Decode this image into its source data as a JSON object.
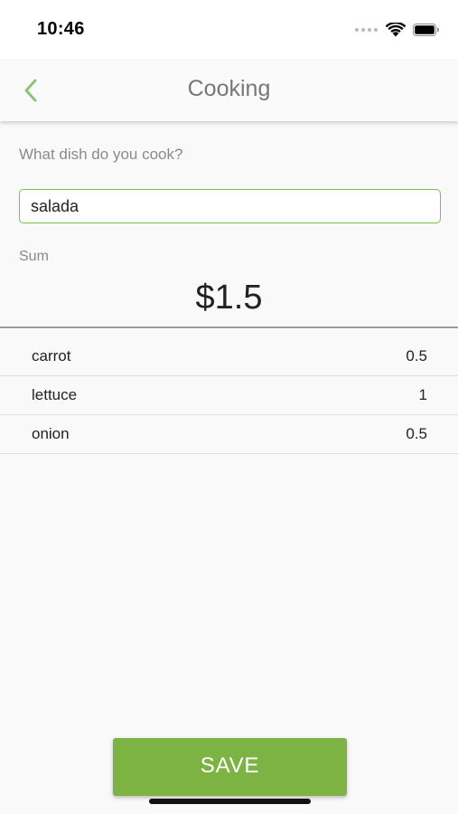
{
  "status_bar": {
    "time": "10:46"
  },
  "nav": {
    "title": "Cooking",
    "back_icon": "chevron-left-icon"
  },
  "form": {
    "question": "What dish do you cook?",
    "dish_value": "salada",
    "sum_label": "Sum",
    "sum_value": "$1.5"
  },
  "ingredients": [
    {
      "name": "carrot",
      "amount": "0.5"
    },
    {
      "name": "lettuce",
      "amount": "1"
    },
    {
      "name": "onion",
      "amount": "0.5"
    }
  ],
  "actions": {
    "save_label": "SAVE"
  },
  "colors": {
    "accent": "#7cb342",
    "input_border": "#7cc04f",
    "title_text": "#777777"
  }
}
